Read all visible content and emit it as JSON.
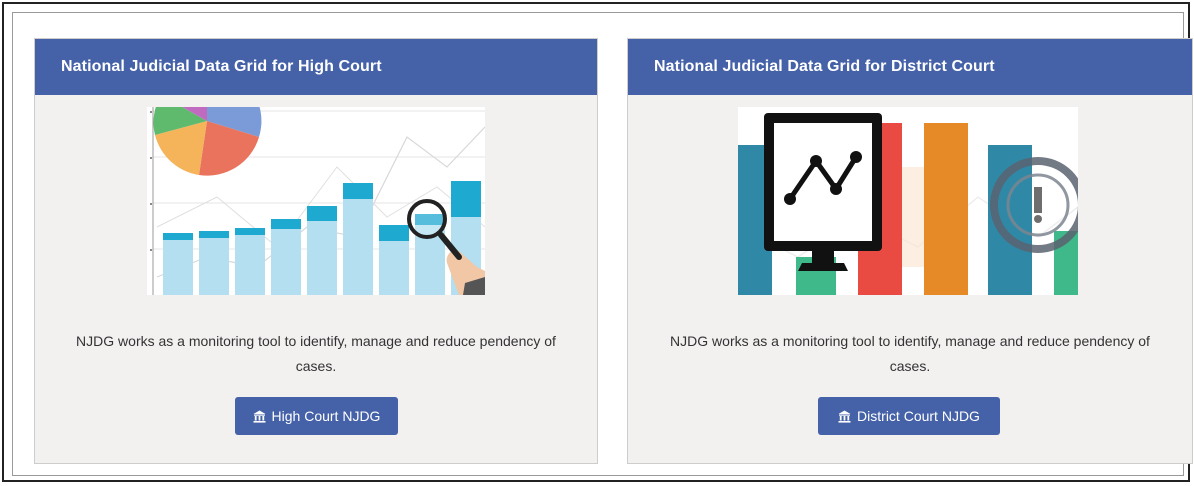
{
  "cards": [
    {
      "title": "National Judicial Data Grid for High Court",
      "description": "NJDG works as a monitoring tool to identify, manage and reduce pendency of cases.",
      "button_label": "High Court NJDG",
      "image": "analytics-chart-illustration",
      "button_icon": "bank-icon"
    },
    {
      "title": "National Judicial Data Grid for District Court",
      "description": "NJDG works as a monitoring tool to identify, manage and reduce pendency of cases.",
      "button_label": "District Court NJDG",
      "image": "monitor-graph-illustration",
      "button_icon": "bank-icon"
    }
  ],
  "colors": {
    "header": "#4561a8",
    "card_bg": "#f3f0f0",
    "button": "#4561a8"
  }
}
